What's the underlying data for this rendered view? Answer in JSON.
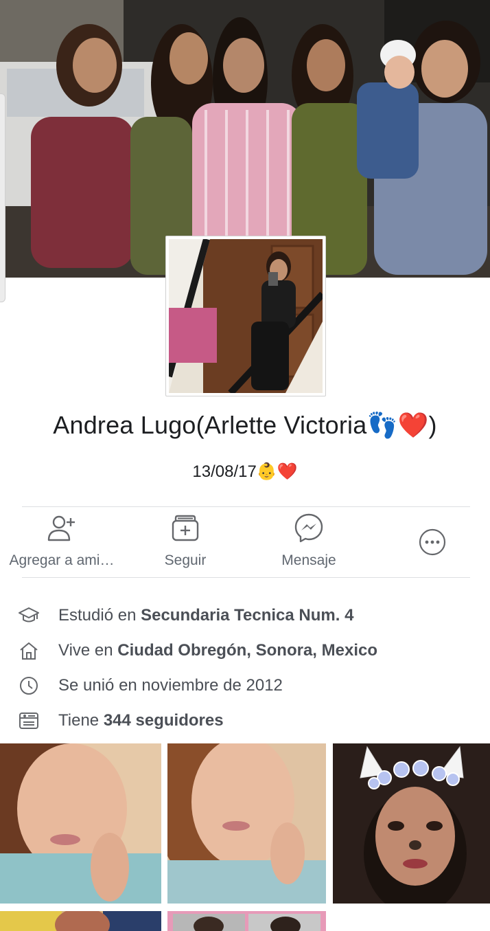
{
  "profile": {
    "name": "Andrea Lugo",
    "alternate_name": "(Arlette Victoria👣❤️)",
    "bio": "13/08/17👶❤️"
  },
  "actions": {
    "add_friend": "Agregar a ami…",
    "follow": "Seguir",
    "message": "Mensaje"
  },
  "about": {
    "education_prefix": "Estudió en ",
    "education_value": "Secundaria Tecnica Num. 4",
    "lives_prefix": "Vive en ",
    "lives_value": "Ciudad Obregón, Sonora, Mexico",
    "joined": "Se unió en noviembre de 2012",
    "followers_prefix": "Tiene ",
    "followers_value": "344 seguidores"
  },
  "icons": [
    "add-friend-icon",
    "follow-icon",
    "messenger-icon",
    "more-icon",
    "graduation-cap-icon",
    "home-icon",
    "clock-icon",
    "followers-icon"
  ],
  "colors": {
    "text": "#1c1e21",
    "secondary": "#606770",
    "icon": "#65676b",
    "divider": "#dddfe2"
  }
}
